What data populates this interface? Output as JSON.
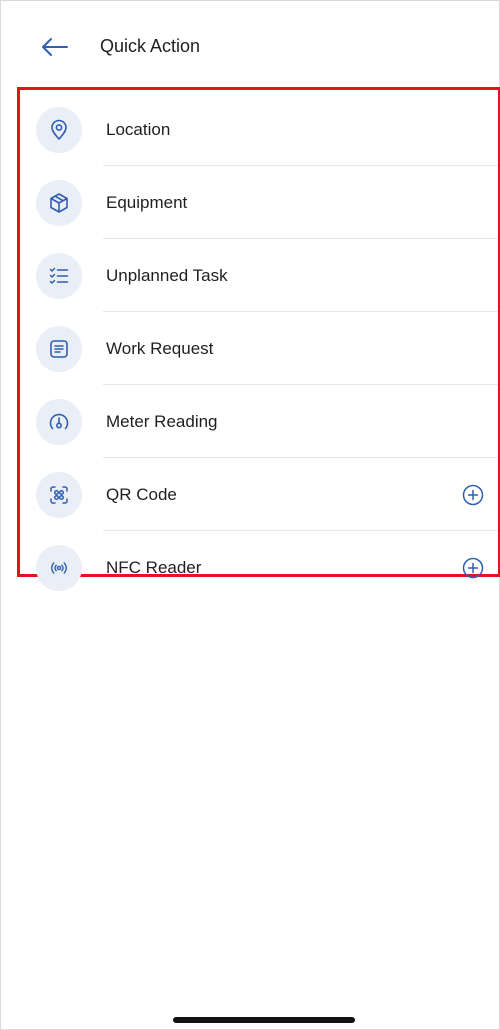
{
  "header": {
    "title": "Quick Action",
    "back_icon": "arrow-left-icon"
  },
  "actions": [
    {
      "label": "Location",
      "icon": "location-pin-icon",
      "has_add": false
    },
    {
      "label": "Equipment",
      "icon": "cube-icon",
      "has_add": false
    },
    {
      "label": "Unplanned Task",
      "icon": "checklist-icon",
      "has_add": false
    },
    {
      "label": "Work Request",
      "icon": "document-list-icon",
      "has_add": false
    },
    {
      "label": "Meter Reading",
      "icon": "meter-gauge-icon",
      "has_add": false
    },
    {
      "label": "QR Code",
      "icon": "qr-scan-icon",
      "has_add": true
    },
    {
      "label": "NFC Reader",
      "icon": "nfc-icon",
      "has_add": true
    }
  ],
  "colors": {
    "accent": "#2f5fb3",
    "icon_bg": "#e9eef7",
    "highlight_border": "#e3141b",
    "text": "#1f1f1f"
  }
}
